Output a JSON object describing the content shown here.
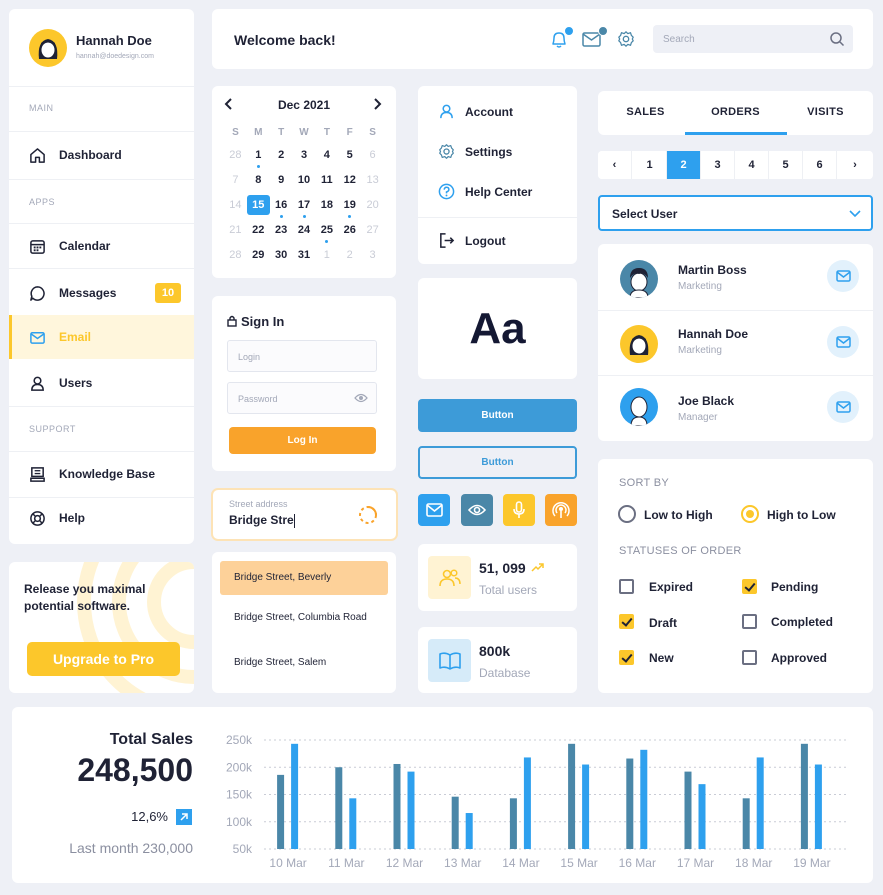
{
  "profile": {
    "name": "Hannah Doe",
    "email": "hannah@doedesign.com"
  },
  "sidebar": {
    "sections": {
      "main": "MAIN",
      "apps": "APPS",
      "support": "SUPPORT"
    },
    "items": [
      {
        "label": "Dashboard"
      },
      {
        "label": "Calendar"
      },
      {
        "label": "Messages",
        "badge": "10"
      },
      {
        "label": "Email"
      },
      {
        "label": "Users"
      },
      {
        "label": "Knowledge Base"
      },
      {
        "label": "Help"
      }
    ]
  },
  "promo": {
    "text": "Release you maximal potential software.",
    "button": "Upgrade to Pro"
  },
  "header": {
    "welcome": "Welcome back!",
    "search_placeholder": "Search"
  },
  "calendar": {
    "month": "Dec 2021",
    "weekdays": [
      "S",
      "M",
      "T",
      "W",
      "T",
      "F",
      "S"
    ],
    "weeks": [
      [
        "28",
        "1",
        "2",
        "3",
        "4",
        "5",
        "6"
      ],
      [
        "7",
        "8",
        "9",
        "10",
        "11",
        "12",
        "13"
      ],
      [
        "14",
        "15",
        "16",
        "17",
        "18",
        "19",
        "20"
      ],
      [
        "21",
        "22",
        "23",
        "24",
        "25",
        "26",
        "27"
      ],
      [
        "28",
        "29",
        "30",
        "31",
        "1",
        "2",
        "3"
      ]
    ]
  },
  "menu": {
    "account": "Account",
    "settings": "Settings",
    "help_center": "Help Center",
    "logout": "Logout"
  },
  "typography": {
    "sample": "Aa"
  },
  "signin": {
    "title": "Sign In",
    "login_placeholder": "Login",
    "password_placeholder": "Password",
    "button": "Log In"
  },
  "buttons": {
    "primary": "Button",
    "outline": "Button"
  },
  "address": {
    "label": "Street address",
    "value": "Bridge Stre",
    "suggestions": [
      "Bridge Street, Beverly",
      "Bridge Street, Columbia Road",
      "Bridge Street, Salem"
    ]
  },
  "stats": {
    "users": {
      "value": "51, 099",
      "label": "Total users"
    },
    "database": {
      "value": "800k",
      "label": "Database"
    }
  },
  "tabs": [
    "SALES",
    "ORDERS",
    "VISITS"
  ],
  "active_tab": "ORDERS",
  "pagination": {
    "prev": "‹",
    "next": "›",
    "pages": [
      "1",
      "2",
      "3",
      "4",
      "5",
      "6"
    ],
    "current": "2"
  },
  "select_user": {
    "label": "Select User"
  },
  "users": [
    {
      "name": "Martin Boss",
      "role": "Marketing"
    },
    {
      "name": "Hannah Doe",
      "role": "Marketing"
    },
    {
      "name": "Joe Black",
      "role": "Manager"
    }
  ],
  "sort": {
    "title": "SORT BY",
    "options": [
      "Low to High",
      "High to Low"
    ],
    "selected": "High to Low",
    "status_title": "STATUSES OF ORDER",
    "statuses": [
      {
        "label": "Expired",
        "checked": false
      },
      {
        "label": "Pending",
        "checked": true
      },
      {
        "label": "Draft",
        "checked": true
      },
      {
        "label": "Completed",
        "checked": false
      },
      {
        "label": "New",
        "checked": true
      },
      {
        "label": "Approved",
        "checked": false
      }
    ]
  },
  "sales": {
    "title": "Total Sales",
    "total": "248,500",
    "change": "12,6%",
    "last_month": "Last month 230,000"
  },
  "colors": {
    "accent_blue": "#2ea0ee",
    "dark_blue": "#4a87a8",
    "yellow": "#fcc72b",
    "orange": "#f9a32b"
  },
  "chart_data": {
    "type": "bar",
    "categories": [
      "10 Mar",
      "11 Mar",
      "12 Mar",
      "13 Mar",
      "14 Mar",
      "15 Mar",
      "16 Mar",
      "17 Mar",
      "18 Mar",
      "19 Mar"
    ],
    "series": [
      {
        "values": [
          186000,
          200000,
          206000,
          146000,
          143000,
          243000,
          216000,
          192000,
          143000,
          243000
        ]
      },
      {
        "values": [
          243000,
          143000,
          192000,
          116000,
          218000,
          205000,
          232000,
          169000,
          218000,
          205000
        ]
      }
    ],
    "yticks": [
      "250k",
      "200k",
      "150k",
      "100k",
      "50k"
    ],
    "ylim": [
      50000,
      250000
    ],
    "grid": true
  }
}
